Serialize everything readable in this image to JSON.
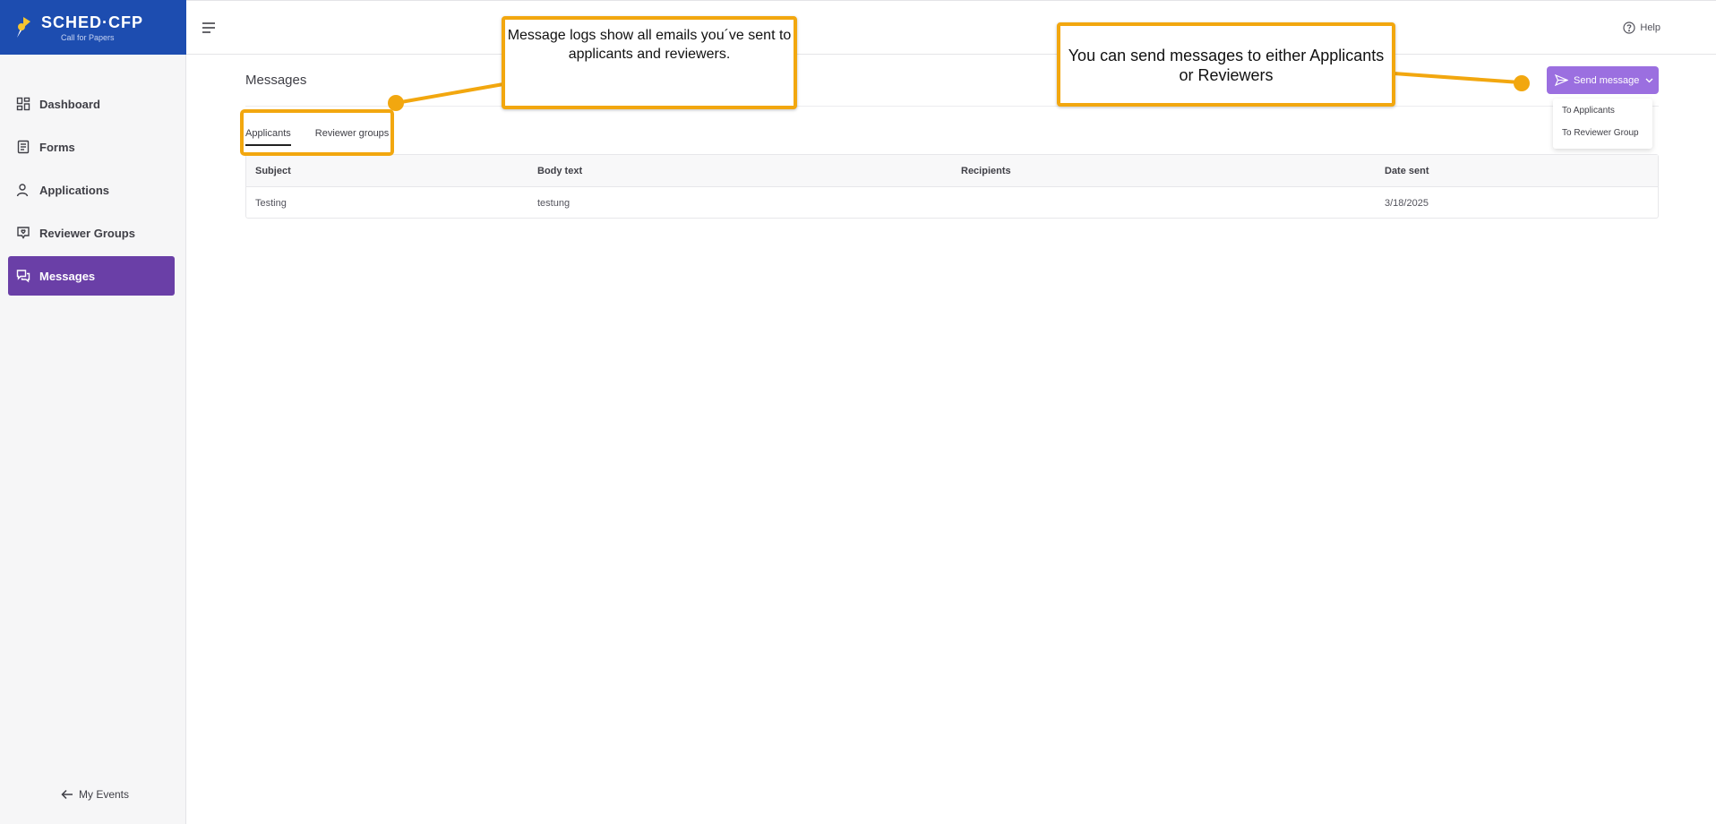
{
  "brand": {
    "name": "SCHED·CFP",
    "subtitle": "Call for Papers"
  },
  "sidebar": {
    "items": [
      {
        "label": "Dashboard",
        "icon": "dashboard-icon",
        "active": false
      },
      {
        "label": "Forms",
        "icon": "form-icon",
        "active": false
      },
      {
        "label": "Applications",
        "icon": "person-icon",
        "active": false
      },
      {
        "label": "Reviewer Groups",
        "icon": "reviewer-badge-icon",
        "active": false
      },
      {
        "label": "Messages",
        "icon": "chat-icon",
        "active": true
      }
    ],
    "footer_label": "My Events"
  },
  "topbar": {
    "help_label": "Help"
  },
  "main": {
    "title": "Messages",
    "tabs": [
      {
        "label": "Applicants",
        "active": true
      },
      {
        "label": "Reviewer groups",
        "active": false
      }
    ],
    "table": {
      "columns": [
        "Subject",
        "Body text",
        "Recipients",
        "Date sent"
      ],
      "rows": [
        {
          "subject": "Testing",
          "body": "testung",
          "recipients": "",
          "date": "3/18/2025"
        }
      ]
    },
    "send_button": {
      "label": "Send message",
      "options": [
        "To Applicants",
        "To Reviewer Group"
      ]
    }
  },
  "annotations": {
    "callout_logs": "Message logs show all emails you´ve sent to applicants and reviewers.",
    "callout_send": "You can send messages to either Applicants or Reviewers"
  },
  "colors": {
    "brand": "#1d4db0",
    "active_nav": "#6a3fa7",
    "send_button": "#9b6fe0",
    "callout_border": "#f2a70f"
  }
}
